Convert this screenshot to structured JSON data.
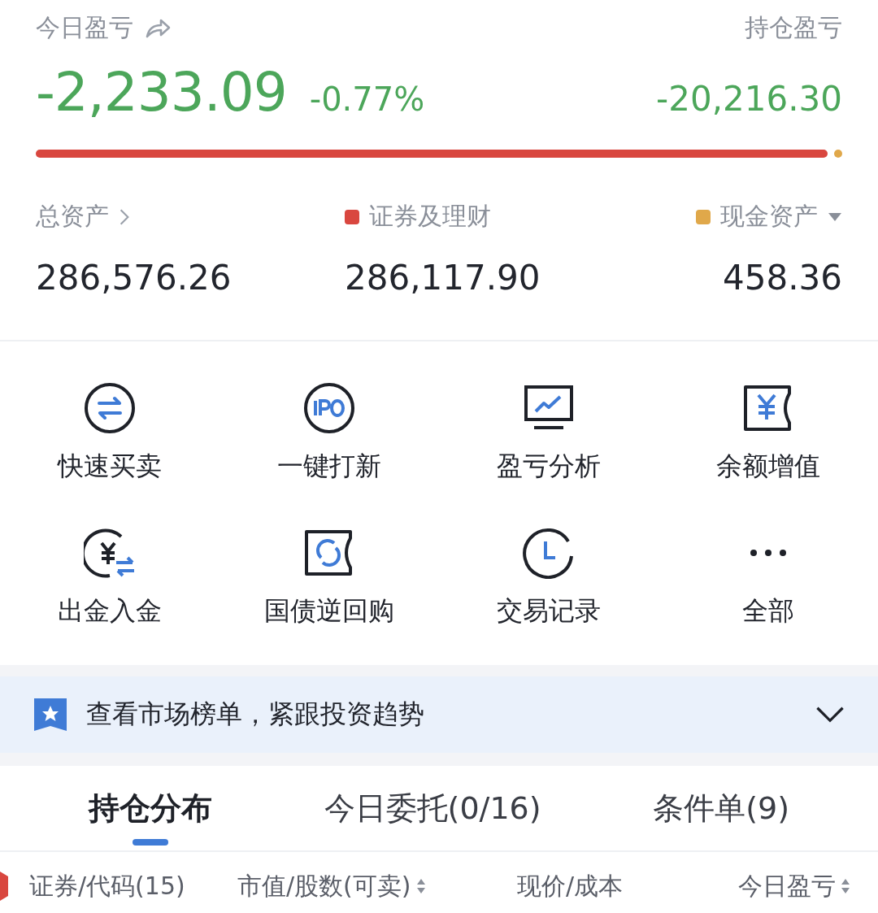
{
  "summary": {
    "today_label": "今日盈亏",
    "holding_label": "持仓盈亏",
    "today_value": "-2,233.09",
    "today_percent": "-0.77%",
    "holding_value": "-20,216.30"
  },
  "assets": [
    {
      "label": "总资产",
      "value": "286,576.26",
      "kind": "total"
    },
    {
      "label": "证券及理财",
      "value": "286,117.90",
      "kind": "legend",
      "color": "#d9473f"
    },
    {
      "label": "现金资产",
      "value": "458.36",
      "kind": "legend-menu",
      "color": "#e0a84a"
    }
  ],
  "shortcuts": [
    {
      "label": "快速买卖",
      "kind": "swap"
    },
    {
      "label": "一键打新",
      "kind": "ipo"
    },
    {
      "label": "盈亏分析",
      "kind": "chart"
    },
    {
      "label": "余额增值",
      "kind": "yen-ticket"
    },
    {
      "label": "出金入金",
      "kind": "yen-transfer"
    },
    {
      "label": "国债逆回购",
      "kind": "refresh-ticket"
    },
    {
      "label": "交易记录",
      "kind": "clock"
    },
    {
      "label": "全部",
      "kind": "more"
    }
  ],
  "banner": {
    "text": "查看市场榜单，紧跟投资趋势"
  },
  "tabs": [
    {
      "label": "持仓分布",
      "selected": true
    },
    {
      "label": "今日委托(0/16)",
      "selected": false
    },
    {
      "label": "条件单(9)",
      "selected": false
    }
  ],
  "columns": [
    {
      "label": "证券/代码(15)",
      "sortable": false
    },
    {
      "label": "市值/股数(可卖)",
      "sortable": true
    },
    {
      "label": "现价/成本",
      "sortable": false
    },
    {
      "label": "今日盈亏",
      "sortable": true
    }
  ]
}
